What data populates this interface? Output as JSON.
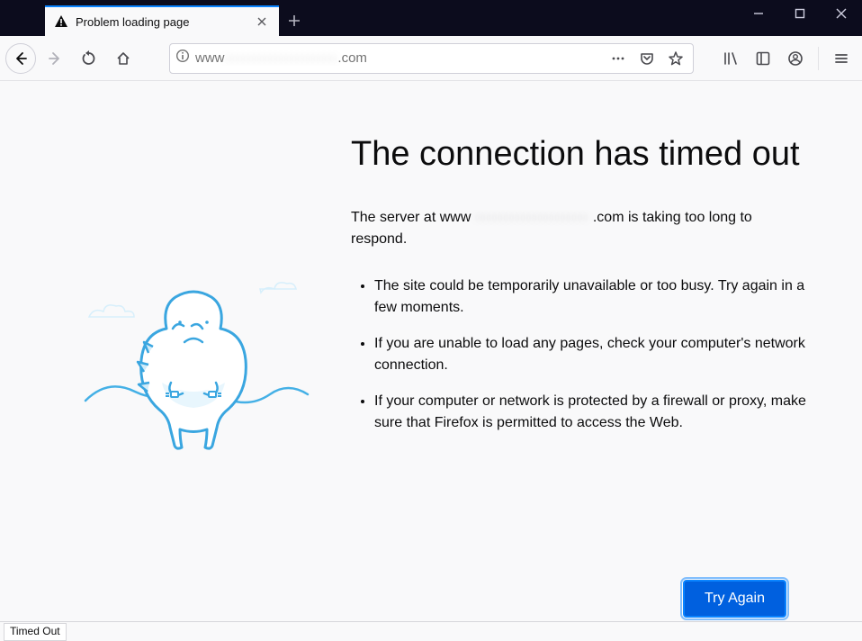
{
  "tab": {
    "title": "Problem loading page"
  },
  "url": {
    "prefix": "www",
    "obscured": "·····················",
    "suffix": ".com"
  },
  "error": {
    "heading": "The connection has timed out",
    "server_prefix": "The server at www",
    "server_obscured": "····················",
    "server_suffix": ".com is taking too long to respond.",
    "bullets": [
      "The site could be temporarily unavailable or too busy. Try again in a few moments.",
      "If you are unable to load any pages, check your computer's network connection.",
      "If your computer or network is protected by a firewall or proxy, make sure that Firefox is permitted to access the Web."
    ],
    "retry_label": "Try Again"
  },
  "status": {
    "label": "Timed Out"
  }
}
